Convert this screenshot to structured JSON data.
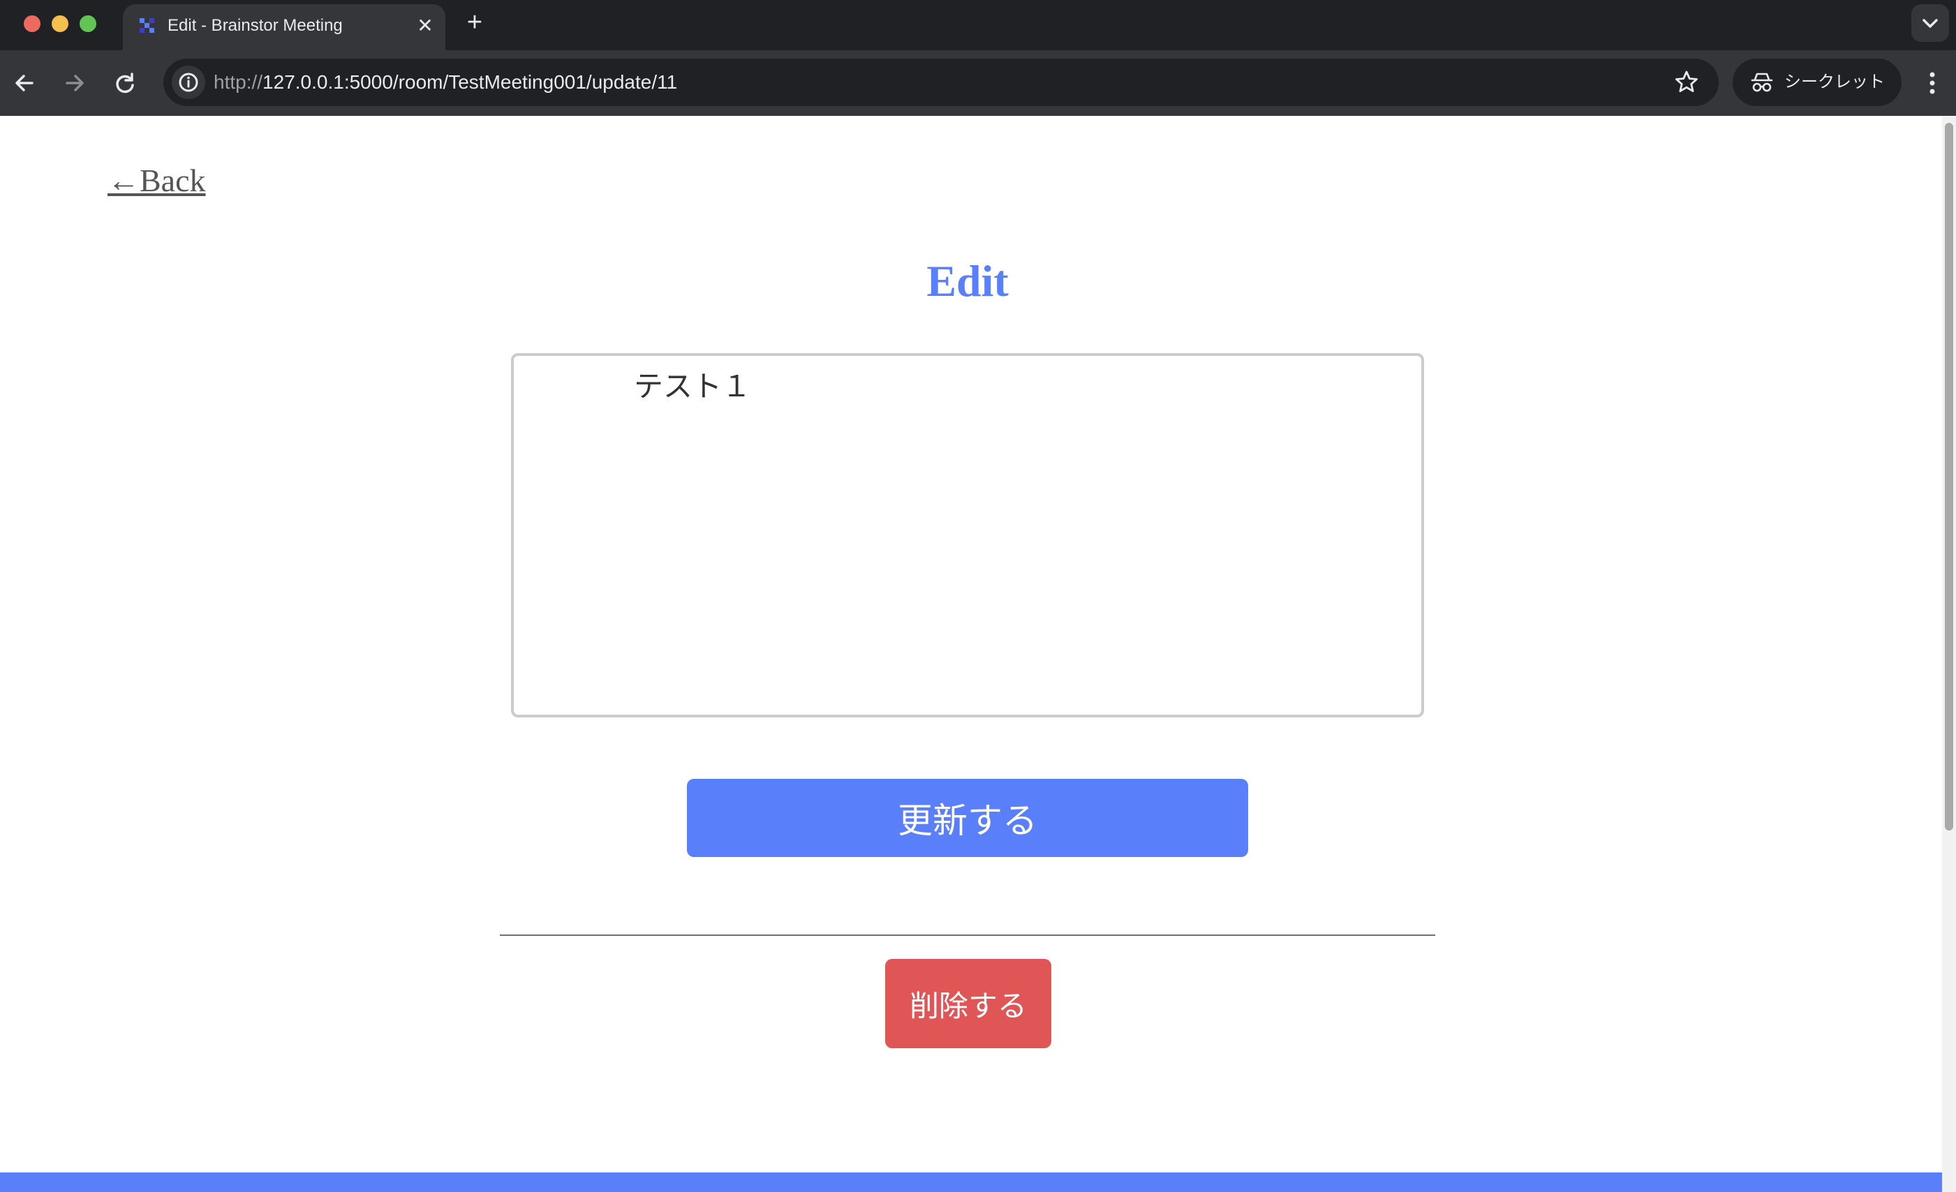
{
  "browser": {
    "tab": {
      "title": "Edit - Brainstor Meeting",
      "favicon": "app-favicon-icon",
      "close_icon": "close-icon"
    },
    "new_tab_icon": "plus-icon",
    "tab_list_icon": "chevron-down-icon",
    "toolbar": {
      "back_icon": "arrow-left-icon",
      "forward_icon": "arrow-right-icon",
      "reload_icon": "reload-icon",
      "site_info_icon": "info-icon",
      "url_scheme": "http://",
      "url_rest": "127.0.0.1:5000/room/TestMeeting001/update/11",
      "bookmark_icon": "star-icon",
      "incognito_label": "シークレット",
      "incognito_icon": "incognito-icon",
      "menu_icon": "kebab-menu-icon"
    }
  },
  "page": {
    "back_link": "←Back",
    "heading": "Edit",
    "textarea_value": "テスト１",
    "update_button": "更新する",
    "delete_button": "削除する"
  },
  "colors": {
    "accent": "#5a7ffa",
    "danger": "#e05555",
    "chrome_dark": "#202124",
    "chrome_mid": "#35363a"
  }
}
